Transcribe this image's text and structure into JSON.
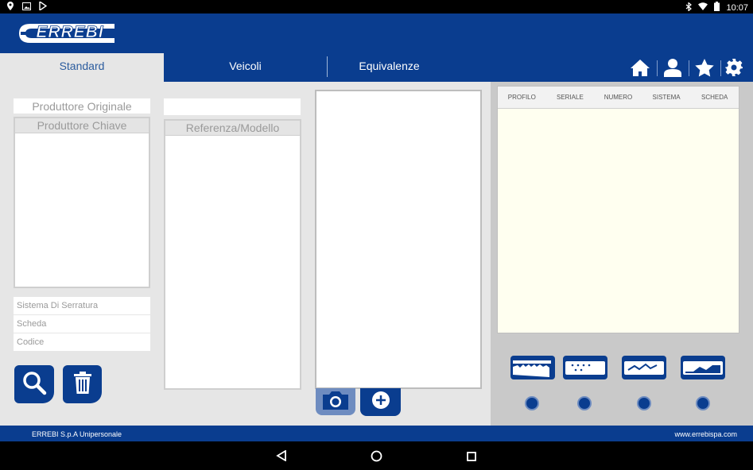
{
  "statusbar": {
    "time": "10:07"
  },
  "app": {
    "logo_text": "ERREBI"
  },
  "tabs": [
    {
      "label": "Standard",
      "active": true
    },
    {
      "label": "Veicoli",
      "active": false
    },
    {
      "label": "Equivalenze",
      "active": false
    }
  ],
  "header_icons": [
    "home-icon",
    "user-icon",
    "star-icon",
    "gear-icon"
  ],
  "left": {
    "produttore_originale": "Produttore Originale",
    "produttore_chiave": "Produttore Chiave",
    "referenza_modello": "Referenza/Modello",
    "sistema": "Sistema Di Serratura",
    "scheda": "Scheda",
    "codice": "Codice"
  },
  "table": {
    "columns": [
      "PROFILO",
      "SERIALE",
      "NUMERO",
      "SISTEMA",
      "SCHEDA"
    ]
  },
  "footer": {
    "company": "ERREBI S.p.A Unipersonale",
    "website": "www.errebispa.com"
  },
  "colors": {
    "primary": "#0a3d8f",
    "background": "#e6e6e6",
    "table_bg": "#fffff0"
  }
}
